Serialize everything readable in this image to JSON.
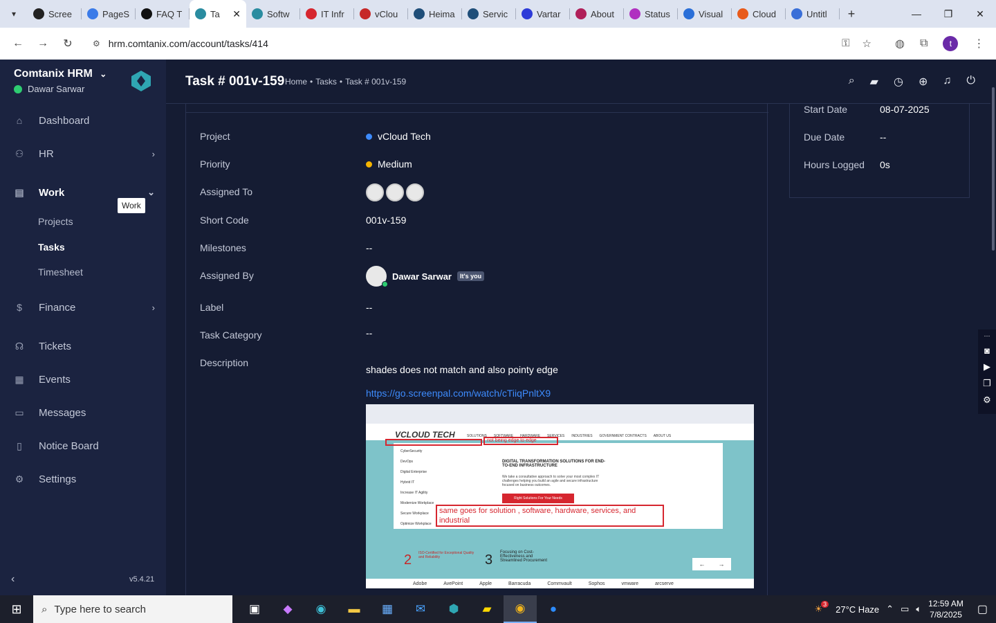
{
  "browser": {
    "tabs": [
      {
        "label": "Scree",
        "color": "#222"
      },
      {
        "label": "PageS",
        "color": "#3b7be8"
      },
      {
        "label": "FAQ T",
        "color": "#111"
      },
      {
        "label": "Ta",
        "color": "#2a8ca0",
        "active": true
      },
      {
        "label": "Softw",
        "color": "#2a8ca0"
      },
      {
        "label": "IT Infr",
        "color": "#d6262f"
      },
      {
        "label": "vClou",
        "color": "#c62828"
      },
      {
        "label": "Heima",
        "color": "#1f4e79"
      },
      {
        "label": "Servic",
        "color": "#1f4e79"
      },
      {
        "label": "Vartar",
        "color": "#2d3bd8"
      },
      {
        "label": "About",
        "color": "#b0205a"
      },
      {
        "label": "Status",
        "color": "#b030c0"
      },
      {
        "label": "Visual",
        "color": "#2a6fd8"
      },
      {
        "label": "Cloud",
        "color": "#e85a1a"
      },
      {
        "label": "Untitl",
        "color": "#3a6fd8"
      }
    ],
    "url": "hrm.comtanix.com/account/tasks/414",
    "profile_initial": "t"
  },
  "sidebar": {
    "brand": "Comtanix HRM",
    "user": "Dawar Sarwar",
    "items": [
      {
        "label": "Dashboard",
        "icon": "home-icon"
      },
      {
        "label": "HR",
        "icon": "people-icon"
      },
      {
        "label": "Work",
        "icon": "briefcase-icon"
      },
      {
        "label": "Finance",
        "icon": "dollar-icon"
      },
      {
        "label": "Tickets",
        "icon": "headset-icon"
      },
      {
        "label": "Events",
        "icon": "calendar-icon"
      },
      {
        "label": "Messages",
        "icon": "message-icon"
      },
      {
        "label": "Notice Board",
        "icon": "clipboard-icon"
      },
      {
        "label": "Settings",
        "icon": "gear-icon"
      }
    ],
    "work_sub": [
      "Projects",
      "Tasks",
      "Timesheet"
    ],
    "tooltip": "Work",
    "version": "v5.4.21"
  },
  "header": {
    "title": "Task # 001v-159",
    "breadcrumb": [
      "Home",
      "Tasks",
      "Task # 001v-159"
    ]
  },
  "task": {
    "labels": {
      "project": "Project",
      "priority": "Priority",
      "assigned_to": "Assigned To",
      "short_code": "Short Code",
      "milestones": "Milestones",
      "assigned_by": "Assigned By",
      "label": "Label",
      "task_category": "Task Category",
      "description": "Description"
    },
    "project": "vCloud Tech",
    "project_color": "#3d8bfd",
    "priority": "Medium",
    "priority_color": "#f5b400",
    "short_code": "001v-159",
    "milestones": "--",
    "assigned_by": "Dawar Sarwar",
    "its_you": "It's you",
    "label": "--",
    "task_category": "--",
    "description_text": "shades does not match and also pointy edge",
    "description_link": "https://go.screenpal.com/watch/cTiiqPnltX9"
  },
  "dates": {
    "start_label": "Start Date",
    "start_value": "08-07-2025",
    "due_label": "Due Date",
    "due_value": "--",
    "hours_label": "Hours Logged",
    "hours_value": "0s"
  },
  "attachment": {
    "logo": "VCLOUD TECH",
    "nav": [
      "SOLUTIONS",
      "SOFTWARE",
      "HARDWARE",
      "SERVICES",
      "INDUSTRIES",
      "GOVERNMENT CONTRACTS",
      "ABOUT US"
    ],
    "menu": [
      "CyberSecurity",
      "DevOps",
      "Digital Enterprise",
      "Hybrid IT",
      "Increase IT Agility",
      "Modernize Workplace",
      "Secure Workplace",
      "Optimize Workplace"
    ],
    "headline": "DIGITAL TRANSFORMATION SOLUTIONS FOR END-TO-END INFRASTRUCTURE",
    "para": "We take a consultative approach to solve your most complex IT challenges helping you build an agile and secure infrastructure focused on business outcomes.",
    "cta": "Right Solutions For Your Needs",
    "note1": "not being edge to edge",
    "note2": "same goes for solution , software, hardware, services, and industrial",
    "num2": "2",
    "text2": "ISO-Certified for Exceptional Quality and Reliability",
    "num3": "3",
    "text3": "Focusing on Cost-Effectiveness and Streamlined Procurement",
    "brands": [
      "Adobe",
      "AvePoint",
      "Apple",
      "Barracuda",
      "Commvault",
      "Sophos",
      "vmware",
      "arcserve"
    ]
  },
  "taskbar": {
    "search_placeholder": "Type here to search",
    "weather": "27°C  Haze",
    "weather_badge": "3",
    "time": "12:59 AM",
    "date": "7/8/2025"
  }
}
